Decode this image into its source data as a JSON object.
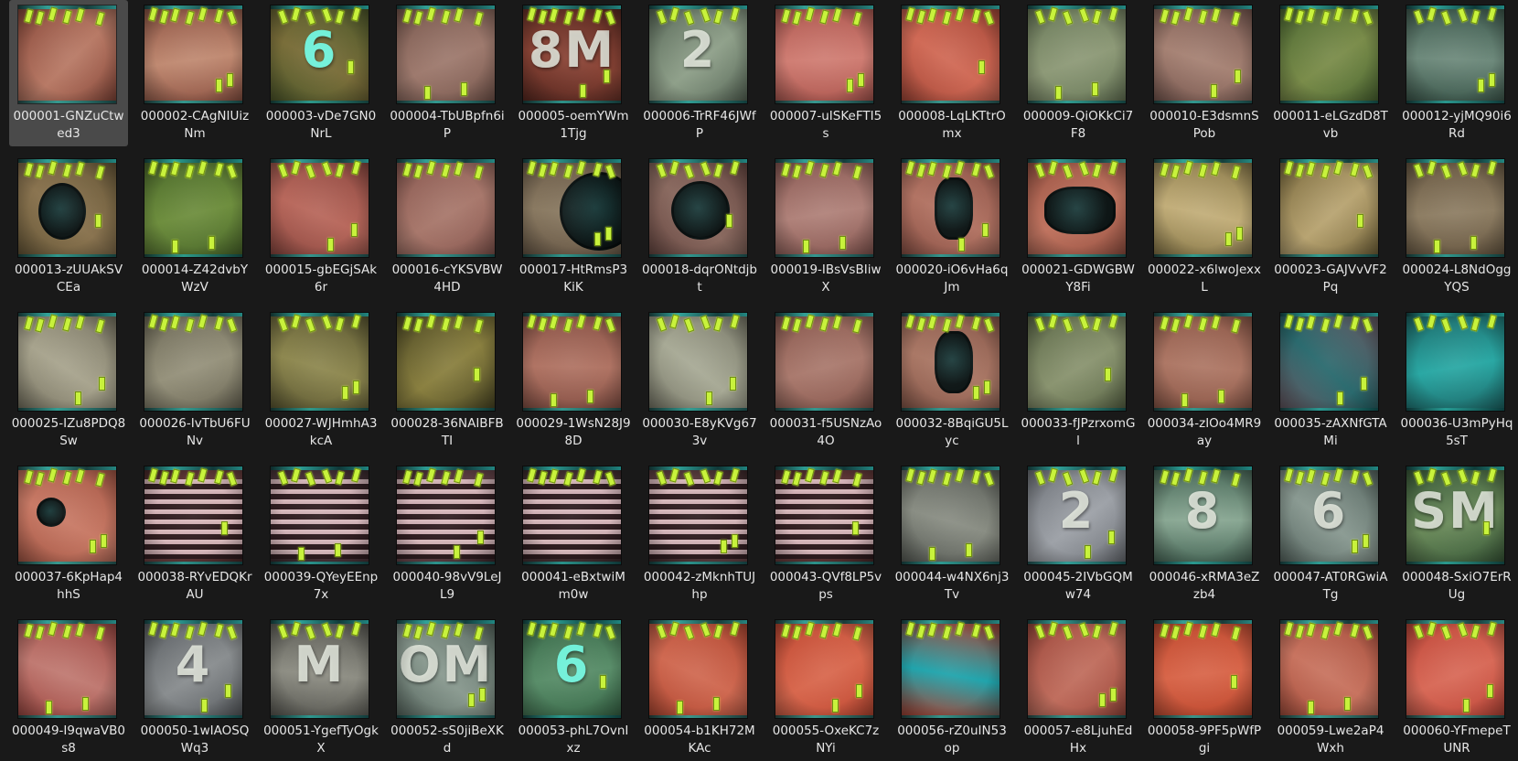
{
  "files": [
    {
      "name": "000001-GNZuCtwed3",
      "colors": [
        "#8a4a3c",
        "#b87a66"
      ],
      "selected": true
    },
    {
      "name": "000002-CAgNIUizNm",
      "colors": [
        "#8e5444",
        "#c08a72"
      ]
    },
    {
      "name": "000003-vDe7GN0NrL",
      "colors": [
        "#4f5a2c",
        "#7a6e3a"
      ],
      "glyph": "6",
      "glyph_color": "teal"
    },
    {
      "name": "000004-TbUBpfn6iP",
      "colors": [
        "#7a5a50",
        "#9e7a6e"
      ]
    },
    {
      "name": "000005-oemYWm1Tjg",
      "colors": [
        "#5a2a22",
        "#8a4436"
      ],
      "glyph": "8M"
    },
    {
      "name": "000006-TrRF46JWfP",
      "colors": [
        "#5a6a5a",
        "#8fa08a"
      ],
      "glyph": "2"
    },
    {
      "name": "000007-uISKeFTI5s",
      "colors": [
        "#b05a52",
        "#d07e74"
      ]
    },
    {
      "name": "000008-LqLKTtrOmx",
      "colors": [
        "#a84a3a",
        "#d06a56"
      ]
    },
    {
      "name": "000009-QiOKkCi7F8",
      "colors": [
        "#6a7a5a",
        "#8e9a78"
      ]
    },
    {
      "name": "000010-E3dsmnSPob",
      "colors": [
        "#7a5a52",
        "#a68274"
      ]
    },
    {
      "name": "000011-eLGzdD8Tvb",
      "colors": [
        "#4e6a34",
        "#7a8c4a"
      ]
    },
    {
      "name": "000012-yjMQ90i6Rd",
      "colors": [
        "#3e5a4e",
        "#6e8a7c"
      ]
    },
    {
      "name": "000013-zUUAkSVCEa",
      "colors": [
        "#6a5a3a",
        "#8a7450"
      ],
      "hole": "oval"
    },
    {
      "name": "000014-Z42dvbYWzV",
      "colors": [
        "#4c6a2c",
        "#6e8e3e"
      ]
    },
    {
      "name": "000015-gbEGjSAk6r",
      "colors": [
        "#8e4a42",
        "#b8685c"
      ]
    },
    {
      "name": "000016-cYKSVBW4HD",
      "colors": [
        "#8a5a52",
        "#a8786c"
      ]
    },
    {
      "name": "000017-HtRmsP3KiK",
      "colors": [
        "#6a5a48",
        "#8a7a62"
      ],
      "hole": "big"
    },
    {
      "name": "000018-dqrONtdjbt",
      "colors": [
        "#6a4a44",
        "#8a6a60"
      ],
      "hole": "round"
    },
    {
      "name": "000019-IBsVsBIiwX",
      "colors": [
        "#8a5a54",
        "#b0827a"
      ]
    },
    {
      "name": "000020-iO6vHa6qJm",
      "colors": [
        "#8e5448",
        "#b27464"
      ],
      "hole": "slot"
    },
    {
      "name": "000021-GDWGBWY8Fi",
      "colors": [
        "#9a5444",
        "#c07460"
      ],
      "hole": "wide"
    },
    {
      "name": "000022-x6lwoJexxL",
      "colors": [
        "#8a7a4a",
        "#c2ae7a"
      ]
    },
    {
      "name": "000023-GAJVvVF2Pq",
      "colors": [
        "#7a6a3e",
        "#b8a472"
      ]
    },
    {
      "name": "000024-L8NdOggYQS",
      "colors": [
        "#6a5a44",
        "#8e7e64"
      ]
    },
    {
      "name": "000025-IZu8PDQ8Sw",
      "colors": [
        "#7a7664",
        "#a8a48e"
      ]
    },
    {
      "name": "000026-IvTbU6FUNv",
      "colors": [
        "#6e6a58",
        "#96927c"
      ]
    },
    {
      "name": "000027-WJHmhA3kcA",
      "colors": [
        "#5e5a34",
        "#8e8850"
      ]
    },
    {
      "name": "000028-36NAIBFBTI",
      "colors": [
        "#4e4a26",
        "#8a8040"
      ]
    },
    {
      "name": "000029-1WsN28J98D",
      "colors": [
        "#8a5448",
        "#b07464"
      ]
    },
    {
      "name": "000030-E8yKVg673v",
      "colors": [
        "#7a7a6a",
        "#a8aa96"
      ]
    },
    {
      "name": "000031-f5USNzAo4O",
      "colors": [
        "#8a5a50",
        "#aa7a6e"
      ]
    },
    {
      "name": "000032-8BqiGU5Lyc",
      "colors": [
        "#8a5a4c",
        "#aa7866"
      ],
      "hole": "slot"
    },
    {
      "name": "000033-fJPzrxomGl",
      "colors": [
        "#5e6a4a",
        "#8a9470"
      ]
    },
    {
      "name": "000034-zIOo4MR9ay",
      "colors": [
        "#8e5a4a",
        "#ae7866"
      ]
    },
    {
      "name": "000035-zAXNfGTAMi",
      "colors": [
        "#6a5a64",
        "#2a6a6e"
      ]
    },
    {
      "name": "000036-U3mPyHq5sT",
      "colors": [
        "#1e6a6a",
        "#2aa8a4"
      ]
    },
    {
      "name": "000037-6KpHap4hhS",
      "colors": [
        "#a85a48",
        "#c87a66"
      ],
      "hole": "small"
    },
    {
      "name": "000038-RYvEDQKrAU",
      "colors": [
        "#4a2a2a",
        "#7a4a4a"
      ],
      "slats": true
    },
    {
      "name": "000039-QYeyEEnp7x",
      "colors": [
        "#3a2a2e",
        "#6a4a52"
      ],
      "slats": true
    },
    {
      "name": "000040-98vV9LeJL9",
      "colors": [
        "#3e2a2e",
        "#6e4a50"
      ],
      "slats": true
    },
    {
      "name": "000041-eBxtwiMm0w",
      "colors": [
        "#3a2a2c",
        "#6a4a4e"
      ],
      "slats": true
    },
    {
      "name": "000042-zMknhTUJhp",
      "colors": [
        "#3e2a2c",
        "#6e4c4e"
      ],
      "slats": true
    },
    {
      "name": "000043-QVf8LP5vps",
      "colors": [
        "#4a2a2a",
        "#7a4848"
      ],
      "slats": true
    },
    {
      "name": "000044-w4NX6nj3Tv",
      "colors": [
        "#5a5e58",
        "#8a8e84"
      ]
    },
    {
      "name": "000045-2IVbGQMw74",
      "colors": [
        "#6e7278",
        "#9ea2a8"
      ],
      "glyph": "2"
    },
    {
      "name": "000046-xRMA3eZzb4",
      "colors": [
        "#4a6a5a",
        "#8aa894"
      ],
      "glyph": "8"
    },
    {
      "name": "000047-AT0RGwiATg",
      "colors": [
        "#5a6a64",
        "#8a9a92"
      ],
      "glyph": "6"
    },
    {
      "name": "000048-SxiO7ErRUg",
      "colors": [
        "#3a5a3a",
        "#6a8a5a"
      ],
      "glyph": "SM"
    },
    {
      "name": "000049-I9qwaVB0s8",
      "colors": [
        "#a04a44",
        "#c07a72"
      ]
    },
    {
      "name": "000050-1wIAOSQWq3",
      "colors": [
        "#5a5e62",
        "#8a8e90"
      ],
      "glyph": "4"
    },
    {
      "name": "000051-YgefTyOgkX",
      "colors": [
        "#5a5a54",
        "#8e8e84"
      ],
      "glyph": "M"
    },
    {
      "name": "000052-sS0jiBeXKd",
      "colors": [
        "#5a6a62",
        "#8a9a90"
      ],
      "glyph": "OM"
    },
    {
      "name": "000053-phL7OvnIxz",
      "colors": [
        "#3a6a4a",
        "#5a8e6a"
      ],
      "glyph": "6",
      "glyph_color": "teal"
    },
    {
      "name": "000054-b1KH72MKAc",
      "colors": [
        "#b44a34",
        "#d06a52"
      ]
    },
    {
      "name": "000055-OxeKC7zNYi",
      "colors": [
        "#c04a34",
        "#d8684e"
      ]
    },
    {
      "name": "000056-rZ0uIN53op",
      "colors": [
        "#b04030",
        "#20a4ac"
      ]
    },
    {
      "name": "000057-e8LjuhEdHx",
      "colors": [
        "#9e4a3e",
        "#c06e5e"
      ]
    },
    {
      "name": "000058-9PF5pWfPgi",
      "colors": [
        "#c04a30",
        "#d8664a"
      ]
    },
    {
      "name": "000059-Lwe2aP4Wxh",
      "colors": [
        "#a8503e",
        "#c87460"
      ]
    },
    {
      "name": "000060-YFmepeTUNR",
      "colors": [
        "#c0483a",
        "#d86a58"
      ]
    }
  ]
}
